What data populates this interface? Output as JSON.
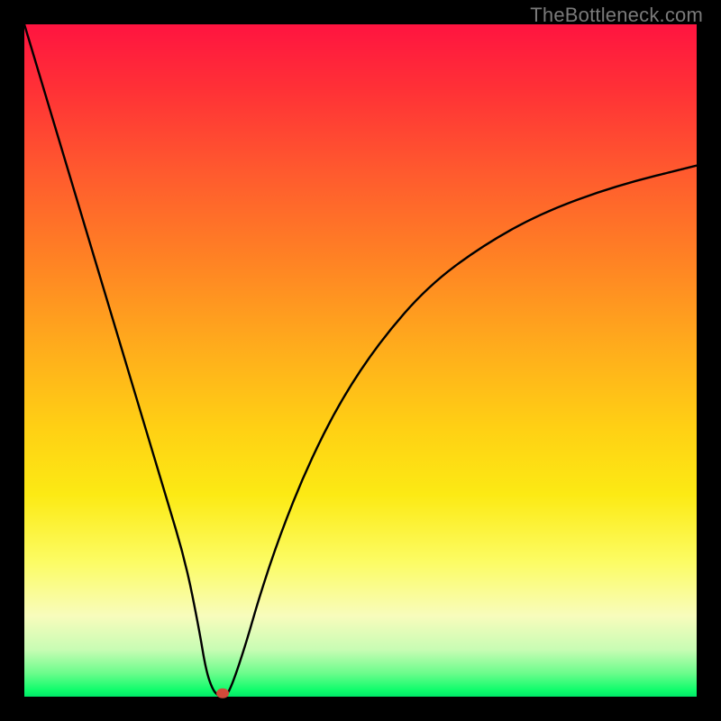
{
  "watermark": "TheBottleneck.com",
  "chart_data": {
    "type": "line",
    "title": "",
    "xlabel": "",
    "ylabel": "",
    "xlim": [
      0,
      100
    ],
    "ylim": [
      0,
      100
    ],
    "grid": false,
    "series": [
      {
        "name": "bottleneck-curve",
        "x": [
          0,
          3,
          6,
          9,
          12,
          15,
          18,
          21,
          24,
          26,
          27,
          28,
          29,
          30,
          31,
          33,
          35,
          38,
          42,
          47,
          53,
          60,
          68,
          77,
          88,
          100
        ],
        "y": [
          100,
          90,
          80,
          70,
          60,
          50,
          40,
          30,
          20,
          10,
          4,
          1,
          0,
          0,
          2,
          8,
          15,
          24,
          34,
          44,
          53,
          61,
          67,
          72,
          76,
          79
        ]
      }
    ],
    "marker": {
      "x": 29.5,
      "y": 0.5,
      "color": "#d24a3a"
    },
    "gradient_stops": [
      {
        "pos": 0.0,
        "color": "#ff1440"
      },
      {
        "pos": 0.1,
        "color": "#ff3236"
      },
      {
        "pos": 0.22,
        "color": "#ff5a2e"
      },
      {
        "pos": 0.35,
        "color": "#ff8224"
      },
      {
        "pos": 0.48,
        "color": "#ffac1c"
      },
      {
        "pos": 0.6,
        "color": "#ffd014"
      },
      {
        "pos": 0.7,
        "color": "#fcea14"
      },
      {
        "pos": 0.8,
        "color": "#fcfc64"
      },
      {
        "pos": 0.88,
        "color": "#f8fcbc"
      },
      {
        "pos": 0.93,
        "color": "#c8fcb4"
      },
      {
        "pos": 0.965,
        "color": "#6cfc8c"
      },
      {
        "pos": 0.99,
        "color": "#10fc6c"
      },
      {
        "pos": 1.0,
        "color": "#00e868"
      }
    ]
  }
}
